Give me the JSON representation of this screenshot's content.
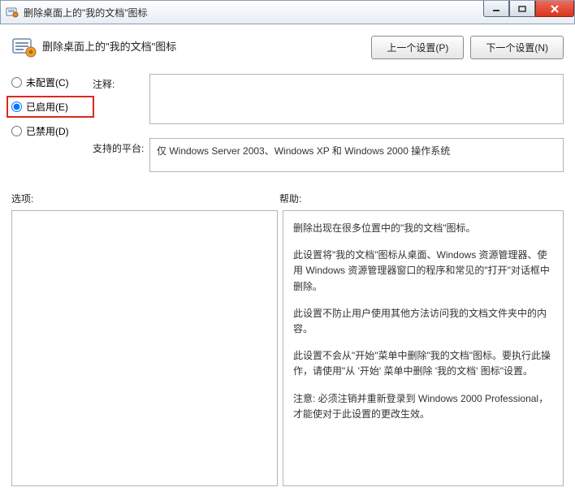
{
  "window": {
    "title": "删除桌面上的\"我的文档\"图标"
  },
  "header": {
    "title": "删除桌面上的\"我的文档\"图标",
    "prev_label": "上一个设置(P)",
    "next_label": "下一个设置(N)"
  },
  "radios": {
    "not_configured": "未配置(C)",
    "enabled": "已启用(E)",
    "disabled": "已禁用(D)"
  },
  "fields": {
    "comment_label": "注释:",
    "comment_value": "",
    "platform_label": "支持的平台:",
    "platform_value": "仅 Windows Server 2003、Windows XP 和 Windows 2000 操作系统"
  },
  "section_labels": {
    "options": "选项:",
    "help": "帮助:"
  },
  "help": {
    "p1": "删除出现在很多位置中的\"我的文档\"图标。",
    "p2": "此设置将\"我的文档\"图标从桌面、Windows 资源管理器、使用 Windows 资源管理器窗口的程序和常见的\"打开\"对话框中删除。",
    "p3": "此设置不防止用户使用其他方法访问我的文档文件夹中的内容。",
    "p4": "此设置不会从\"开始\"菜单中删除\"我的文档\"图标。要执行此操作，请使用\"从 '开始' 菜单中删除 '我的文档' 图标\"设置。",
    "p5": "注意: 必须注销并重新登录到 Windows 2000 Professional，才能使对于此设置的更改生效。"
  }
}
